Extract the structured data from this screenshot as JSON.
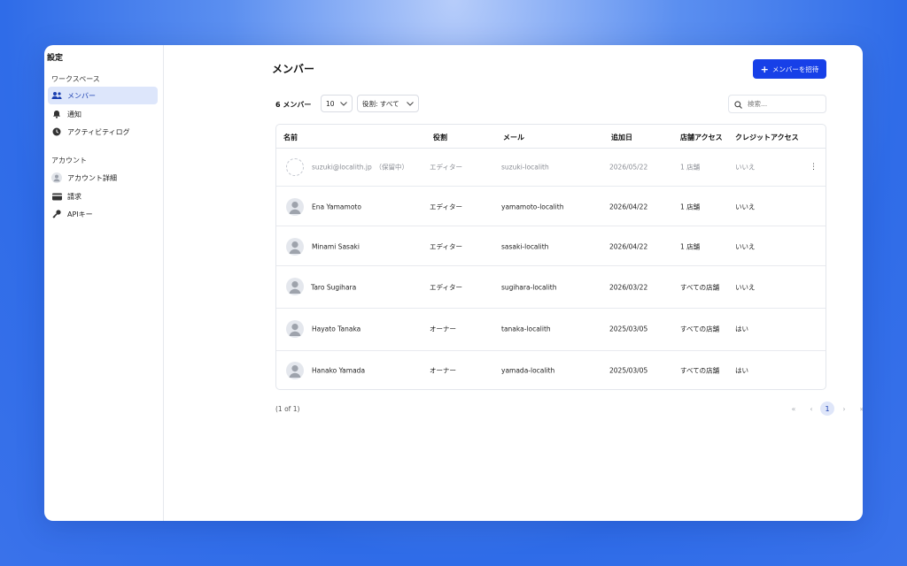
{
  "sidebar": {
    "title": "設定",
    "workspace_label": "ワークスペース",
    "workspace_items": [
      {
        "label": "メンバー"
      },
      {
        "label": "通知"
      },
      {
        "label": "アクティビティログ"
      }
    ],
    "account_label": "アカウント",
    "account_items": [
      {
        "label": "アカウント詳細"
      },
      {
        "label": "請求"
      },
      {
        "label": "APIキー"
      }
    ]
  },
  "header": {
    "title": "メンバー",
    "invite_label": "メンバーを招待"
  },
  "toolbar": {
    "member_count": "6 メンバー",
    "page_size": "10",
    "role_filter": "役割: すべて",
    "search_placeholder": "検索..."
  },
  "table": {
    "columns": [
      "名前",
      "役割",
      "メール",
      "追加日",
      "店舗アクセス",
      "クレジットアクセス"
    ],
    "rows": [
      {
        "name": "suzuki@localith.jp　（保留中）",
        "role": "エディター",
        "email": "suzuki-localith",
        "added": "2026/05/22",
        "store": "1 店舗",
        "credit": "いいえ"
      },
      {
        "name": "Ena Yamamoto",
        "role": "エディター",
        "email": "yamamoto-localith",
        "added": "2026/04/22",
        "store": "1 店舗",
        "credit": "いいえ"
      },
      {
        "name": "Minami Sasaki",
        "role": "エディター",
        "email": "sasaki-localith",
        "added": "2026/04/22",
        "store": "1 店舗",
        "credit": "いいえ"
      },
      {
        "name": "Taro Sugihara",
        "role": "エディター",
        "email": "sugihara-localith",
        "added": "2026/03/22",
        "store": "すべての店舗",
        "credit": "いいえ"
      },
      {
        "name": "Hayato Tanaka",
        "role": "オーナー",
        "email": "tanaka-localith",
        "added": "2025/03/05",
        "store": "すべての店舗",
        "credit": "はい"
      },
      {
        "name": "Hanako Yamada",
        "role": "オーナー",
        "email": "yamada-localith",
        "added": "2025/03/05",
        "store": "すべての店舗",
        "credit": "はい"
      }
    ]
  },
  "footer": {
    "page_info": "(1 of 1)",
    "first": "«",
    "prev": "‹",
    "current_page": "1",
    "next": "›",
    "last": "»"
  },
  "colors": {
    "accent": "#1740e8",
    "active_nav_bg": "#dde6fb"
  }
}
